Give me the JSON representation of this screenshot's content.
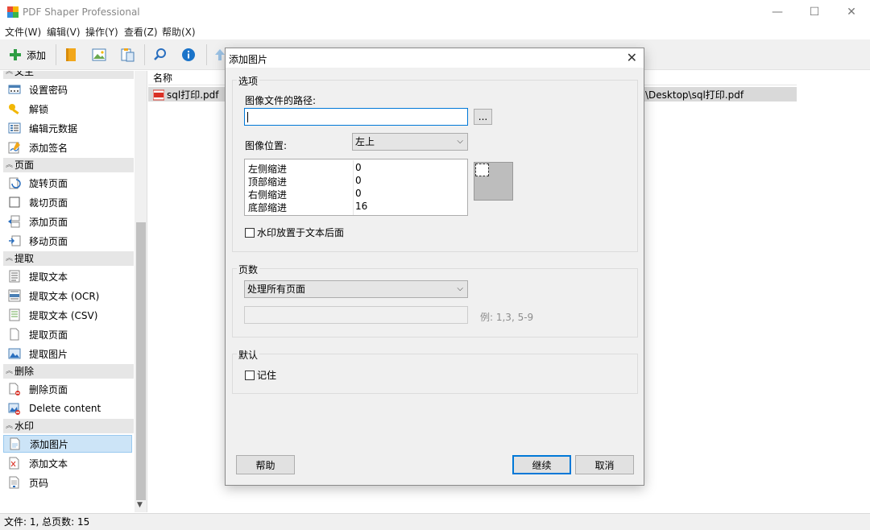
{
  "window": {
    "title": "PDF Shaper Professional",
    "minimize": "—",
    "maximize": "☐",
    "close": "✕"
  },
  "menu": [
    "文件(W)",
    "编辑(V)",
    "操作(Y)",
    "查看(Z)",
    "帮助(X)"
  ],
  "toolbar": {
    "add_label": "添加"
  },
  "sidebar": {
    "top_partial": "文主",
    "items_security": [
      "设置密码",
      "解锁",
      "编辑元数据",
      "添加签名"
    ],
    "group_pages": "页面",
    "items_pages": [
      "旋转页面",
      "裁切页面",
      "添加页面",
      "移动页面"
    ],
    "group_extract": "提取",
    "items_extract": [
      "提取文本",
      "提取文本 (OCR)",
      "提取文本 (CSV)",
      "提取页面",
      "提取图片"
    ],
    "group_delete": "删除",
    "items_delete": [
      "删除页面",
      "Delete content"
    ],
    "group_watermark": "水印",
    "items_watermark": [
      "添加图片",
      "添加文本",
      "页码"
    ]
  },
  "filelist": {
    "header_name": "名称",
    "file_name": "sql打印.pdf",
    "file_path": "\\Desktop\\sql打印.pdf"
  },
  "status": "文件: 1, 总页数: 15",
  "dialog": {
    "title": "添加图片",
    "close": "✕",
    "options_group": "选项",
    "image_path_label": "图像文件的路径:",
    "image_path_value": "",
    "browse_label": "...",
    "image_position_label": "图像位置:",
    "image_position_value": "左上",
    "indents": [
      {
        "key": "左侧缩进",
        "value": "0"
      },
      {
        "key": "顶部缩进",
        "value": "0"
      },
      {
        "key": "右侧缩进",
        "value": "0"
      },
      {
        "key": "底部缩进",
        "value": "16"
      }
    ],
    "behind_text_label": "水印放置于文本后面",
    "behind_text_checked": false,
    "pages_group": "页数",
    "pages_value": "处理所有页面",
    "pages_range_value": "",
    "pages_hint": "例: 1,3, 5-9",
    "defaults_group": "默认",
    "remember_label": "记住",
    "remember_checked": false,
    "help_button": "帮助",
    "continue_button": "继续",
    "cancel_button": "取消"
  }
}
